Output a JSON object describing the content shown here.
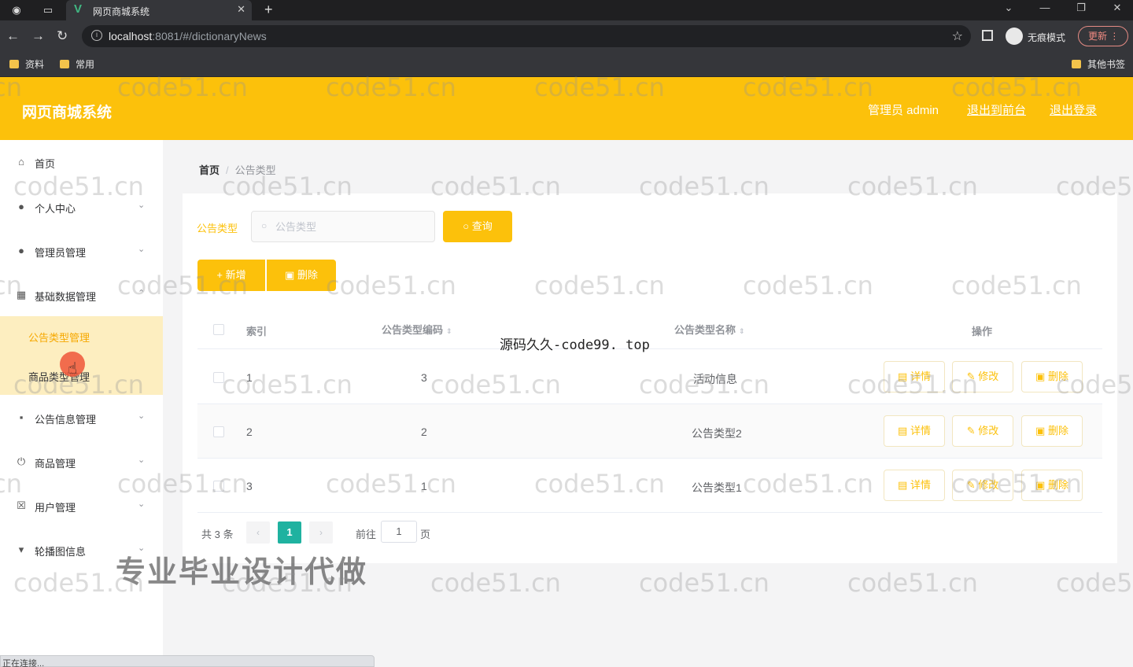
{
  "browser": {
    "tab_title": "网页商城系统",
    "url_host": "localhost",
    "url_rest": ":8081/#/dictionaryNews",
    "incognito_label": "无痕模式",
    "update_label": "更新",
    "bookmarks": [
      "资料",
      "常用"
    ],
    "other_bookmarks": "其他书签",
    "status_text": "正在连接..."
  },
  "header": {
    "title": "网页商城系统",
    "user": "管理员 admin",
    "to_front": "退出到前台",
    "logout": "退出登录"
  },
  "sidebar": {
    "items": [
      {
        "label": "首页",
        "icon": "home-icon",
        "expandable": false
      },
      {
        "label": "个人中心",
        "icon": "user-icon",
        "expandable": true
      },
      {
        "label": "管理员管理",
        "icon": "bulb-icon",
        "expandable": true
      },
      {
        "label": "基础数据管理",
        "icon": "grid-icon",
        "expandable": true
      },
      {
        "label": "公告信息管理",
        "icon": "apps-icon",
        "expandable": true
      },
      {
        "label": "商品管理",
        "icon": "power-icon",
        "expandable": true
      },
      {
        "label": "用户管理",
        "icon": "box-icon",
        "expandable": true
      },
      {
        "label": "轮播图信息",
        "icon": "pin-icon",
        "expandable": true
      }
    ],
    "sub_items": [
      {
        "label": "公告类型管理",
        "active": true
      },
      {
        "label": "商品类型管理",
        "active": false
      }
    ]
  },
  "breadcrumb": {
    "home": "首页",
    "current": "公告类型"
  },
  "filter": {
    "label": "公告类型",
    "placeholder": "公告类型",
    "query_label": "查询"
  },
  "actions": {
    "add_label": "新增",
    "delete_label": "删除"
  },
  "table": {
    "headers": {
      "index": "索引",
      "code": "公告类型编码",
      "name": "公告类型名称",
      "ops": "操作"
    },
    "rows": [
      {
        "index": "1",
        "code": "3",
        "name": "活动信息"
      },
      {
        "index": "2",
        "code": "2",
        "name": "公告类型2"
      },
      {
        "index": "3",
        "code": "1",
        "name": "公告类型1"
      }
    ],
    "op_labels": {
      "detail": "详情",
      "edit": "修改",
      "delete": "删除"
    }
  },
  "pagination": {
    "total": "共 3 条",
    "current": "1",
    "goto_label": "前往",
    "goto_value": "1",
    "unit": "页"
  },
  "overlays": {
    "source_text": "源码久久-code99. top",
    "ad_text": "专业毕业设计代做",
    "watermark": "code51.cn"
  },
  "colors": {
    "accent": "#fcc10b",
    "page_active": "#1fb2a0"
  }
}
